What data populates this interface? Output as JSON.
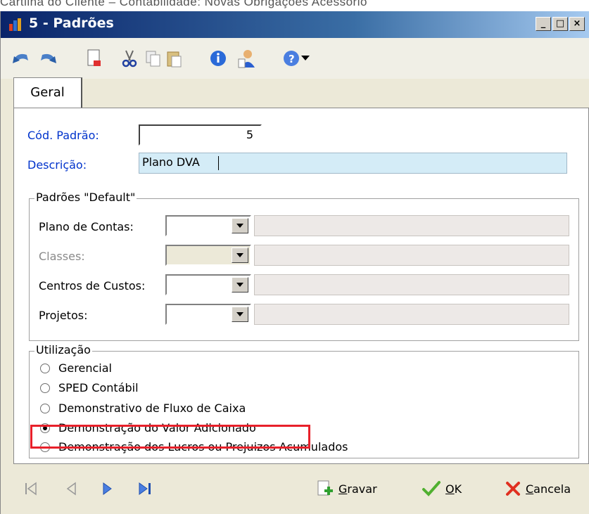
{
  "caption": "Cartilha do Cliente – Contabilidade: Novas Obrigações Acessório",
  "window": {
    "title": "5 - Padrões",
    "buttons": {
      "minimize": "_",
      "maximize": "□",
      "close": "×"
    }
  },
  "toolbar": {
    "icons": [
      "undo-icon",
      "redo-icon",
      "new-document-icon",
      "cut-icon",
      "copy-icon",
      "paste-icon",
      "info-icon",
      "user-icon",
      "help-icon",
      "dropdown-arrow-icon"
    ]
  },
  "tabs": [
    {
      "label": "Geral",
      "selected": true
    }
  ],
  "form": {
    "cod_label": "Cód. Padrão:",
    "cod_value": "5",
    "desc_label": "Descrição:",
    "desc_value": "Plano DVA"
  },
  "defaults": {
    "legend": "Padrões \"Default\"",
    "rows": [
      {
        "label": "Plano de Contas:",
        "enabled": true
      },
      {
        "label": "Classes:",
        "enabled": false
      },
      {
        "label": "Centros de Custos:",
        "enabled": true
      },
      {
        "label": "Projetos:",
        "enabled": true
      }
    ]
  },
  "utilizacao": {
    "legend": "Utilização",
    "options": [
      {
        "label": "Gerencial",
        "checked": false
      },
      {
        "label": "SPED Contábil",
        "checked": false
      },
      {
        "label": "Demonstrativo de Fluxo de Caixa",
        "checked": false
      },
      {
        "label": "Demonstração do Valor Adicionado",
        "checked": true
      },
      {
        "label": "Demonstração dos Lucros ou Prejuizos Acumulados",
        "checked": false
      }
    ]
  },
  "bottom": {
    "nav": [
      "first-record-icon",
      "previous-record-icon",
      "next-record-icon",
      "last-record-icon"
    ],
    "gravar": {
      "prefix": "",
      "underline": "G",
      "rest": "ravar"
    },
    "ok": {
      "underline": "O",
      "rest": "K"
    },
    "cancela": {
      "underline": "C",
      "rest": "ancela"
    }
  },
  "colors": {
    "title_bar_start": "#0a246a",
    "blue_label": "#0033cc",
    "highlight": "#e8202a",
    "desc_field": "#d4ecf7"
  }
}
